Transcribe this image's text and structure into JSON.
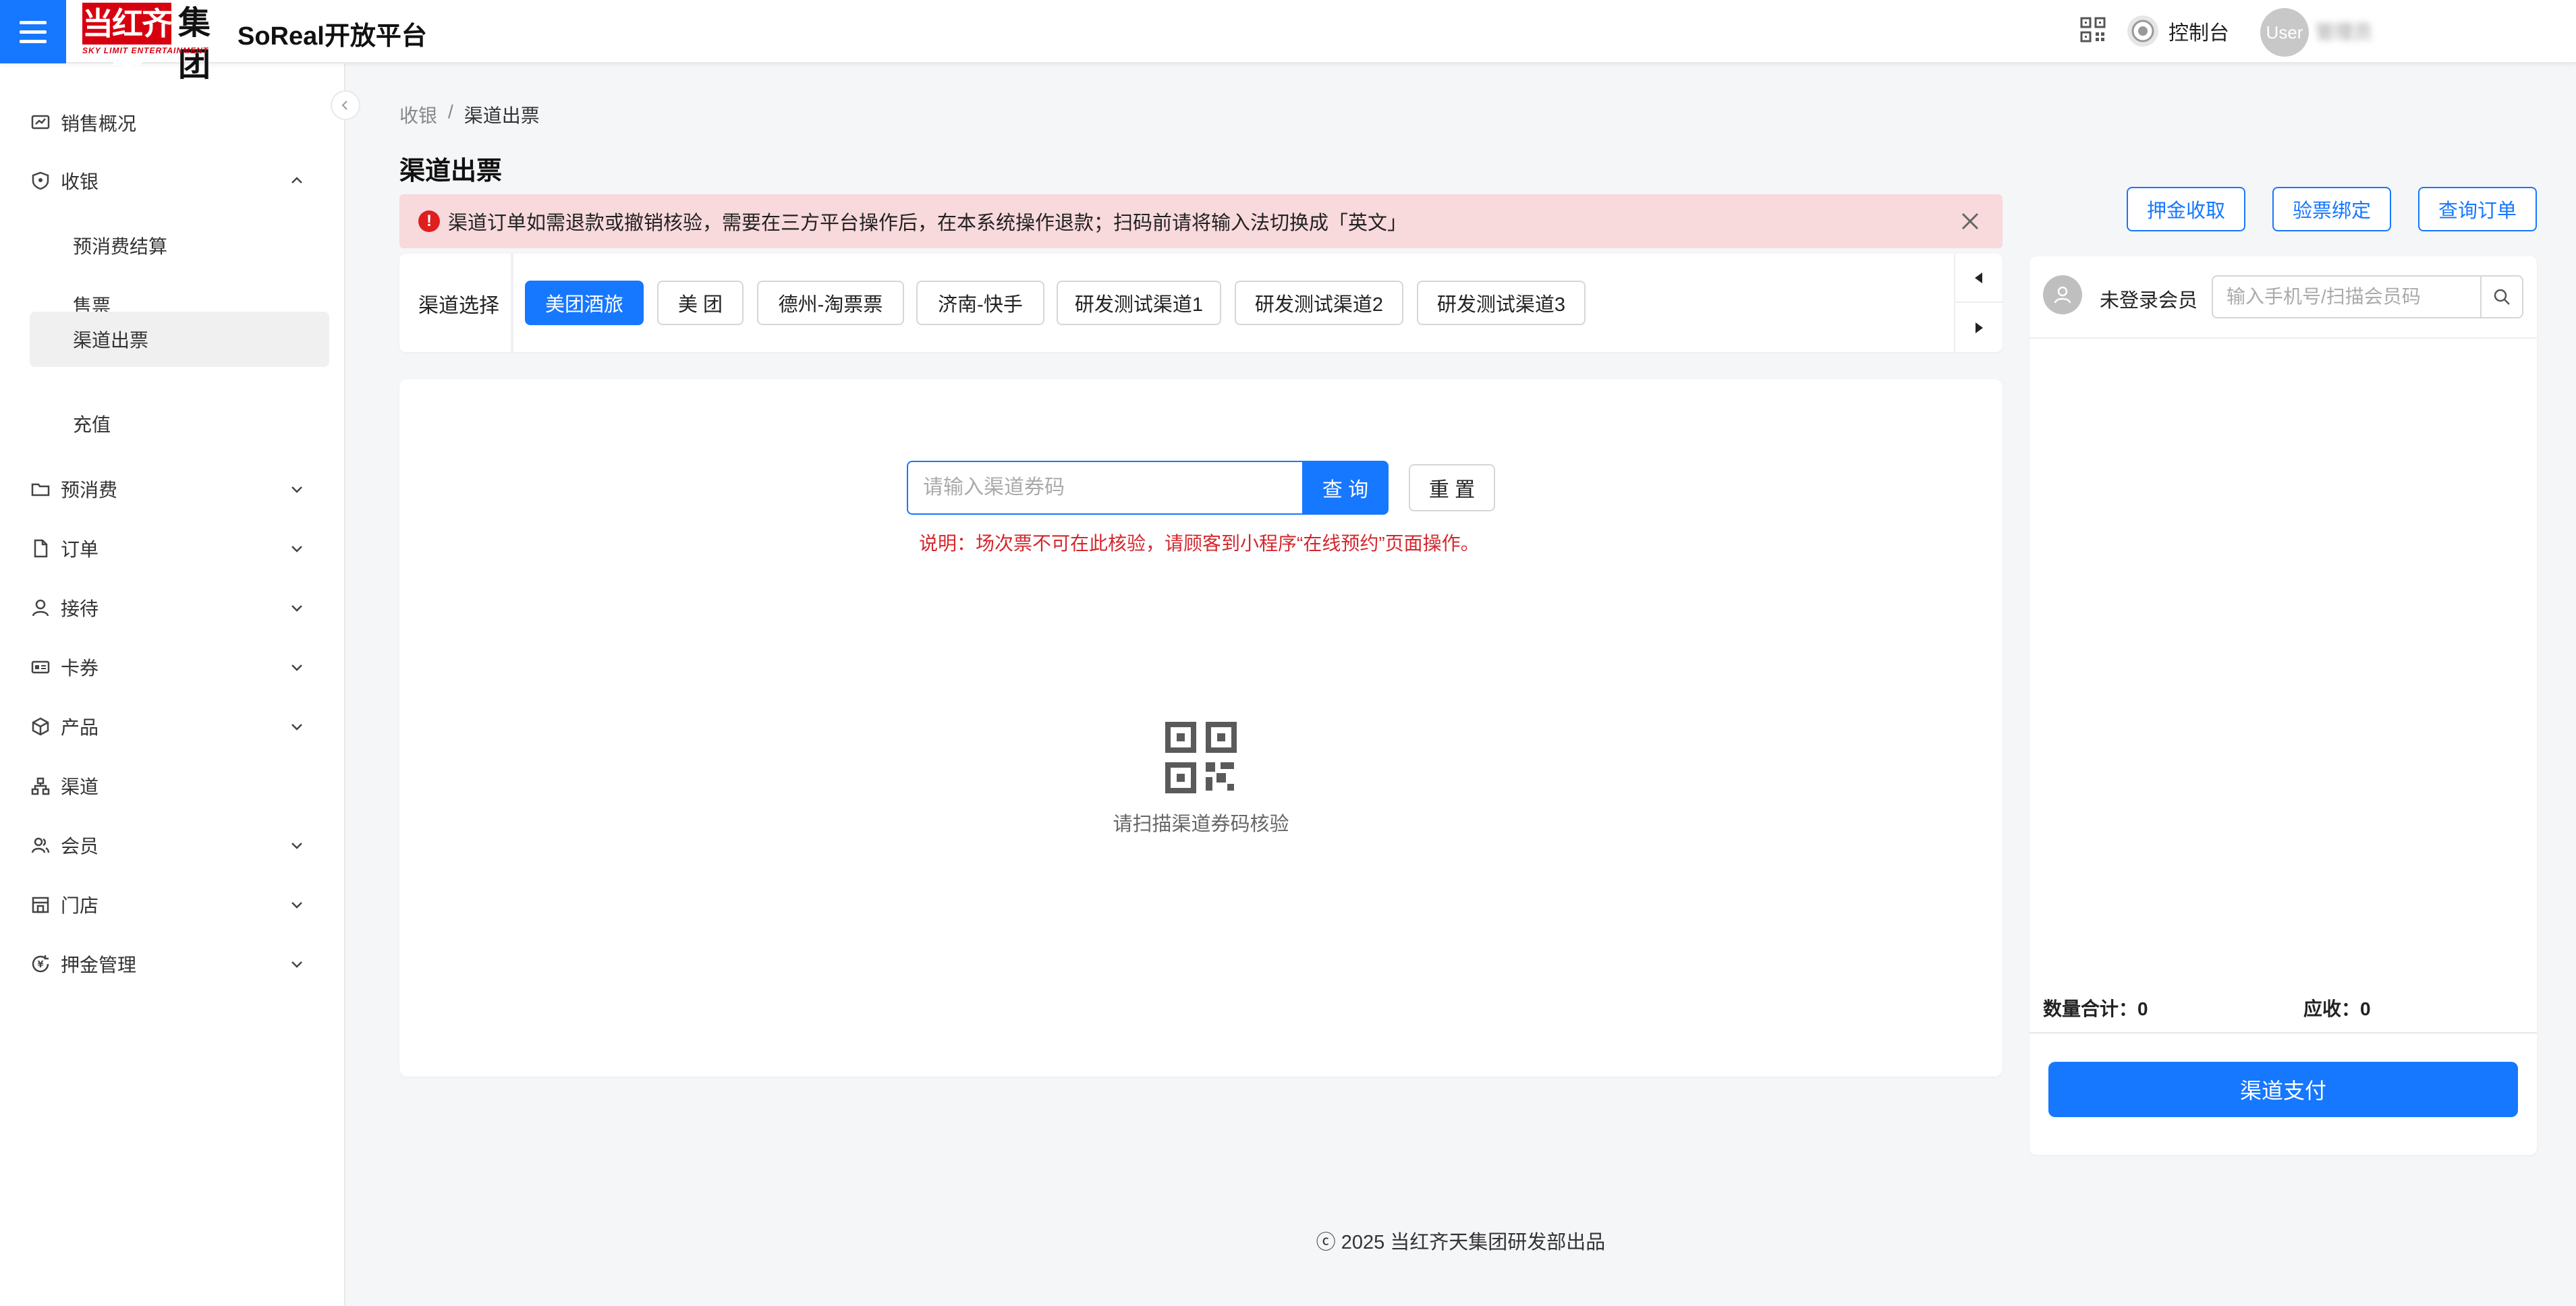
{
  "header": {
    "logo_main": "当红齐天",
    "logo_char": "集团",
    "logo_sub": "SKY LIMIT ENTERTAINMENT",
    "app_title": "SoReal开放平台",
    "console_label": "控制台",
    "avatar_text": "User",
    "user_name": "管理员"
  },
  "sidebar": {
    "items": [
      {
        "label": "销售概况",
        "icon": "chart-icon"
      },
      {
        "label": "收银",
        "icon": "shield-icon",
        "expanded": true
      },
      {
        "label": "预消费",
        "icon": "folder-icon"
      },
      {
        "label": "订单",
        "icon": "file-icon"
      },
      {
        "label": "接待",
        "icon": "user-icon"
      },
      {
        "label": "卡券",
        "icon": "card-icon"
      },
      {
        "label": "产品",
        "icon": "cube-icon"
      },
      {
        "label": "渠道",
        "icon": "channel-icon"
      },
      {
        "label": "会员",
        "icon": "members-icon"
      },
      {
        "label": "门店",
        "icon": "store-icon"
      },
      {
        "label": "押金管理",
        "icon": "deposit-icon"
      }
    ],
    "cashier_sub": [
      {
        "label": "预消费结算"
      },
      {
        "label": "售票"
      },
      {
        "label": "渠道出票",
        "active": true
      },
      {
        "label": "充值"
      }
    ]
  },
  "breadcrumb": {
    "parent": "收银",
    "separator": "/",
    "current": "渠道出票"
  },
  "page_title": "渠道出票",
  "alert": {
    "text": "渠道订单如需退款或撤销核验，需要在三方平台操作后，在本系统操作退款；扫码前请将输入法切换成「英文」"
  },
  "channels": {
    "label": "渠道选择",
    "options": [
      "美团酒旅",
      "美 团",
      "德州-淘票票",
      "济南-快手",
      "研发测试渠道1",
      "研发测试渠道2",
      "研发测试渠道3"
    ],
    "selected": "美团酒旅"
  },
  "scan": {
    "placeholder": "请输入渠道券码",
    "query_label": "查 询",
    "reset_label": "重 置",
    "note": "说明：场次票不可在此核验，请顾客到小程序“在线预约”页面操作。",
    "hint": "请扫描渠道券码核验"
  },
  "actions": {
    "deposit": "押金收取",
    "ticket_bind": "验票绑定",
    "query_order": "查询订单"
  },
  "member": {
    "status": "未登录会员",
    "placeholder": "输入手机号/扫描会员码",
    "qty_label": "数量合计：",
    "qty_value": "0",
    "due_label": "应收：",
    "due_value": "0",
    "pay_label": "渠道支付"
  },
  "footer": {
    "text": "ⓒ 2025 当红齐天集团研发部出品"
  },
  "colors": {
    "primary": "#1677ff",
    "alert_bg": "#f8d9dc",
    "alert_icon": "#e01e1e",
    "note": "#d4272d",
    "brand_red": "#d7000f"
  }
}
